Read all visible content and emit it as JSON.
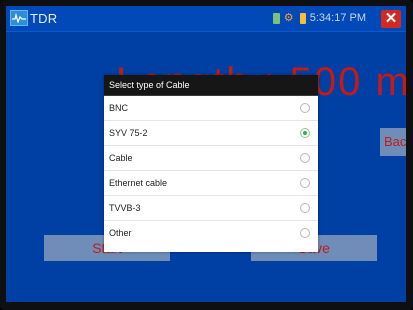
{
  "app": {
    "title": "TDR",
    "icon": "tdr-waveform-icon"
  },
  "statusbar": {
    "time": "5:34:17 PM",
    "icons": [
      "phone-icon",
      "gear-icon",
      "battery-icon"
    ],
    "close_label": "✕"
  },
  "main": {
    "length_readout": "Length : 500 m",
    "side_button_label": "Back",
    "start_button_label": "Start",
    "save_button_label": "Save"
  },
  "dialog": {
    "title": "Select type of Cable",
    "options": [
      {
        "label": "BNC",
        "selected": false
      },
      {
        "label": "SYV 75-2",
        "selected": true
      },
      {
        "label": "Cable",
        "selected": false
      },
      {
        "label": "Ethernet cable",
        "selected": false
      },
      {
        "label": "TVVB-3",
        "selected": false
      },
      {
        "label": "Other",
        "selected": false
      }
    ]
  },
  "colors": {
    "background": "#003fa3",
    "accent_text": "#c51b14",
    "radio_selected": "#2fb34a",
    "dialog_header": "#161616"
  }
}
